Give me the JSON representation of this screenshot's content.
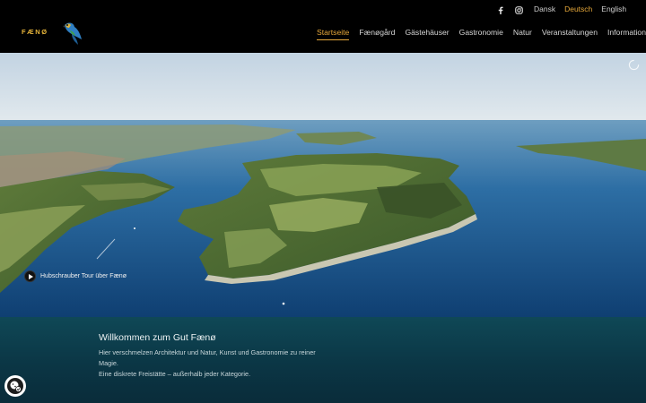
{
  "brand": {
    "logo_text": "FÆNØ"
  },
  "social": {
    "facebook_icon": "facebook-icon",
    "instagram_icon": "instagram-icon"
  },
  "languages": [
    {
      "label": "Dansk",
      "active": false
    },
    {
      "label": "Deutsch",
      "active": true
    },
    {
      "label": "English",
      "active": false
    }
  ],
  "nav": [
    {
      "label": "Startseite",
      "active": true
    },
    {
      "label": "Fænøgård",
      "active": false
    },
    {
      "label": "Gästehäuser",
      "active": false
    },
    {
      "label": "Gastronomie",
      "active": false
    },
    {
      "label": "Natur",
      "active": false
    },
    {
      "label": "Veranstaltungen",
      "active": false
    },
    {
      "label": "Information",
      "active": false
    }
  ],
  "hero": {
    "video_label": "Hubschrauber Tour über Fænø"
  },
  "welcome": {
    "title": "Willkommen zum Gut Fænø",
    "line1": "Hier verschmelzen Architektur und Natur, Kunst und Gastronomie zu reiner Magie.",
    "line2": "Eine diskrete Freistätte – außerhalb jeder Kategorie."
  },
  "colors": {
    "accent": "#e6a83a",
    "header_bg": "#000000",
    "welcome_bg": "#0f4856",
    "sea": "#1c5a92"
  }
}
